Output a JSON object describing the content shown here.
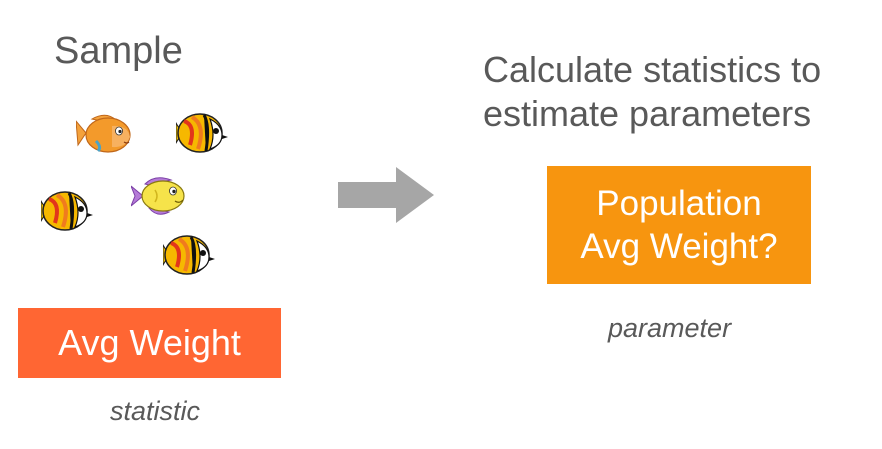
{
  "sample": {
    "title": "Sample",
    "statistic_label": "Avg Weight",
    "statistic_caption": "statistic"
  },
  "estimate": {
    "title": "Calculate statistics to estimate parameters",
    "parameter_line1": "Population",
    "parameter_line2": "Avg Weight?",
    "parameter_caption": "parameter"
  },
  "colors": {
    "statistic_box": "#ff6633",
    "parameter_box": "#f7950f",
    "arrow": "#a6a6a6",
    "text": "#595959"
  },
  "icons": {
    "fish": [
      "orange-fish-icon",
      "butterfly-fish-icon",
      "butterfly-fish-icon",
      "yellow-fish-icon",
      "butterfly-fish-icon"
    ],
    "arrow": "right-arrow-icon"
  }
}
